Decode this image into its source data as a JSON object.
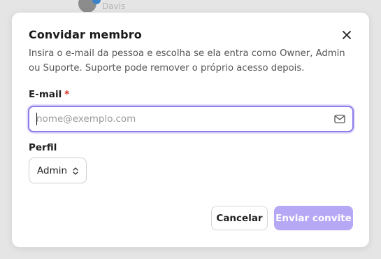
{
  "backdrop": {
    "user_name": "Davis"
  },
  "dialog": {
    "title": "Convidar membro",
    "description": "Insira o e-mail da pessoa e escolha se ela entra como Owner, Admin ou Suporte. Suporte pode remover o próprio acesso depois.",
    "close_icon": "close-icon"
  },
  "email": {
    "label": "E-mail",
    "required_marker": "*",
    "placeholder": "nome@exemplo.com",
    "value": "",
    "icon": "mail-icon"
  },
  "role": {
    "label": "Perfil",
    "selected": "Admin",
    "icon": "chevron-up-down-icon"
  },
  "actions": {
    "cancel_label": "Cancelar",
    "submit_label": "Enviar convite"
  },
  "colors": {
    "accent": "#8b7ce8",
    "accent_disabled": "#b6a8f5",
    "required": "#d92d20",
    "backdrop": "#e5e5e5"
  }
}
